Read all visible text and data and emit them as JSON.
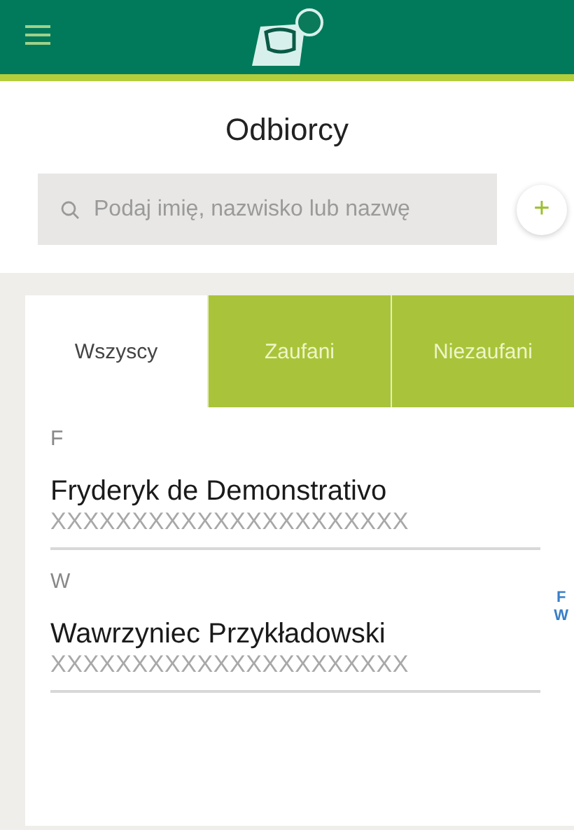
{
  "title": "Odbiorcy",
  "search": {
    "placeholder": "Podaj imię, nazwisko lub nazwę"
  },
  "add_button": "+",
  "tabs": [
    {
      "label": "Wszyscy",
      "selected": true
    },
    {
      "label": "Zaufani",
      "selected": false
    },
    {
      "label": "Niezaufani",
      "selected": false
    }
  ],
  "sections": [
    {
      "letter": "F",
      "contacts": [
        {
          "name": "Fryderyk de Demonstrativo",
          "account": "XXXXXXXXXXXXXXXXXXXXXX"
        }
      ]
    },
    {
      "letter": "W",
      "contacts": [
        {
          "name": "Wawrzyniec Przykładowski",
          "account": "XXXXXXXXXXXXXXXXXXXXXX"
        }
      ]
    }
  ],
  "index": [
    "F",
    "W"
  ]
}
